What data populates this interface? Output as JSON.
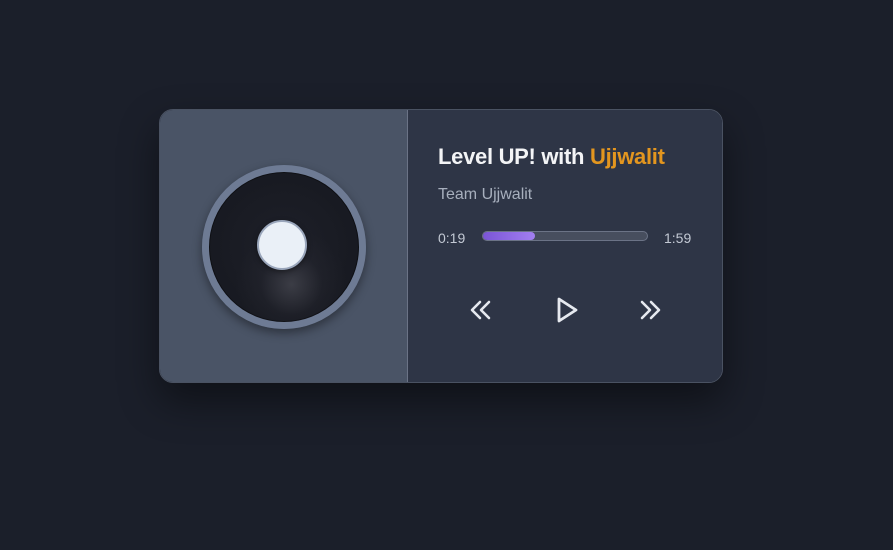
{
  "track": {
    "title_prefix": "Level UP! with ",
    "title_accent": "Ujjwalit",
    "artist": "Team Ujjwalit"
  },
  "playback": {
    "current_time": "0:19",
    "total_time": "1:59",
    "progress_fraction": 0.32
  },
  "controls": {
    "prev_icon": "double-chevron-left-icon",
    "play_icon": "play-icon",
    "next_icon": "double-chevron-right-icon"
  },
  "colors": {
    "accent": "#e3961f",
    "progress": "#8a63e0",
    "background": "#1b1f2a"
  }
}
